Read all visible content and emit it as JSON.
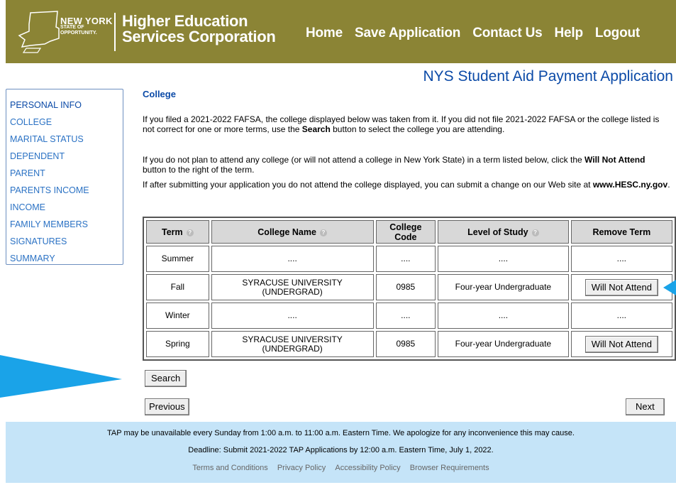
{
  "header": {
    "logo": {
      "line1": "NEW YORK",
      "line2": "STATE OF",
      "line3": "OPPORTUNITY."
    },
    "org_line1": "Higher Education",
    "org_line2": "Services Corporation",
    "nav": {
      "home": "Home",
      "save": "Save Application",
      "contact": "Contact Us",
      "help": "Help",
      "logout": "Logout"
    }
  },
  "app_title": "NYS Student Aid Payment Application",
  "sidebar": {
    "items": [
      "PERSONAL INFO",
      "COLLEGE",
      "MARITAL STATUS",
      "DEPENDENT",
      "PARENT",
      "PARENTS INCOME",
      "INCOME",
      "FAMILY MEMBERS",
      "SIGNATURES",
      "SUMMARY"
    ]
  },
  "main": {
    "heading": "College",
    "p1_a": "If you filed a 2021-2022 FAFSA, the college displayed below was taken from it. If you did not file 2021-2022 FAFSA or the college listed is not correct for one or more terms, use the ",
    "p1_b": "Search",
    "p1_c": " button to select the college you are attending.",
    "p2_a": "If you do not plan to attend any college (or will not attend a college in New York State) in a term listed below, click the ",
    "p2_b": "Will Not Attend",
    "p2_c": " button to the right of the term.",
    "p3_a": "If after submitting your application you do not attend the college displayed, you can submit a change on our Web site at ",
    "p3_b": "www.HESC.ny.gov",
    "p3_c": "."
  },
  "table": {
    "headers": {
      "term": "Term",
      "college": "College Name",
      "code_1": "College",
      "code_2": "Code",
      "level": "Level of Study",
      "remove": "Remove Term"
    },
    "rows": [
      {
        "term": "Summer",
        "college": "....",
        "code": "....",
        "level": "....",
        "remove": "...."
      },
      {
        "term": "Fall",
        "college_1": "SYRACUSE UNIVERSITY",
        "college_2": "(UNDERGRAD)",
        "code": "0985",
        "level": "Four-year Undergraduate",
        "button": "Will Not Attend"
      },
      {
        "term": "Winter",
        "college": "....",
        "code": "....",
        "level": "....",
        "remove": "...."
      },
      {
        "term": "Spring",
        "college_1": "SYRACUSE UNIVERSITY",
        "college_2": "(UNDERGRAD)",
        "code": "0985",
        "level": "Four-year Undergraduate",
        "button": "Will Not Attend"
      }
    ]
  },
  "buttons": {
    "search": "Search",
    "previous": "Previous",
    "next": "Next"
  },
  "footer": {
    "line1": "TAP may be unavailable every Sunday from 1:00 a.m. to 11:00 a.m. Eastern Time. We apologize for any inconvenience this may cause.",
    "line2": "Deadline: Submit 2021-2022 TAP Applications by 12:00 a.m. Eastern Time, July 1, 2022.",
    "links": [
      "Terms and Conditions",
      "Privacy Policy",
      "Accessibility Policy",
      "Browser Requirements"
    ]
  },
  "colors": {
    "header_bg": "#8b8435",
    "link_blue": "#2b72c4",
    "title_blue": "#0b4aa7",
    "footer_bg": "#c5e4f8",
    "arrow": "#1aa3e8"
  }
}
